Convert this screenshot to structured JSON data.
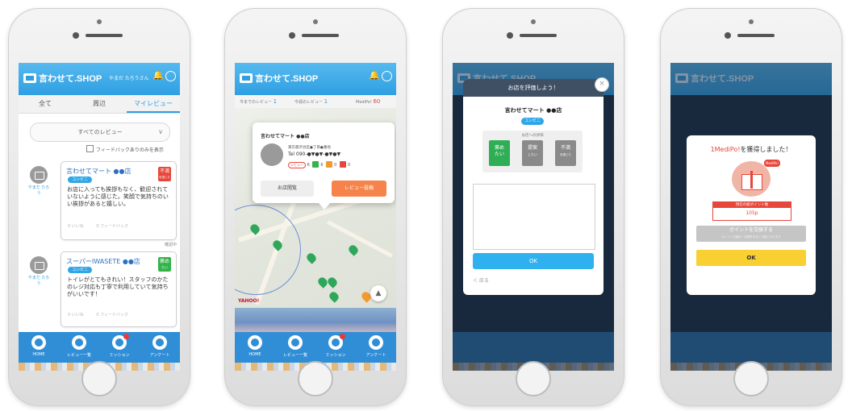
{
  "app": {
    "logo_text": "言わせて.SHOP",
    "username": "やまだ たろうさん"
  },
  "colors": {
    "brand_blue": "#2f9fe2",
    "accent_orange": "#f5834a",
    "positive_green": "#33b34a",
    "negative_red": "#e7463a",
    "ok_yellow": "#f8d031"
  },
  "screen1": {
    "tabs": [
      {
        "label": "全て"
      },
      {
        "label": "周辺"
      },
      {
        "label": "マイレビュー"
      }
    ],
    "dropdown": {
      "value": "すべてのレビュー"
    },
    "filter_checkbox": {
      "label": "フィードバックありのみを表示"
    },
    "reviews": [
      {
        "author": "やまだ たろう",
        "shop": "言わせてマート ●●店",
        "category": "コンビニ",
        "badge": "不満",
        "badge_sub": "を感じた",
        "body": "お店に入っても挨拶もなく、歓迎されていないように感じた。笑顔で気持ちのいい挨拶があると嬉しい。",
        "like_label": "0 いいね",
        "feedback_label": "0 フィードバック",
        "status": "確認中"
      },
      {
        "author": "やまだ たろう",
        "shop": "スーパーIWASETE ●●店",
        "category": "コンビニ",
        "badge": "褒め",
        "badge_sub": "たい",
        "body": "トイレがとてもきれい！スタッフのかたのレジ対応も丁寧で利用していて気持ちがいいです！",
        "like_label": "0 いいね",
        "feedback_label": "0 フィードバック"
      }
    ]
  },
  "nav": [
    {
      "label": "HOME"
    },
    {
      "label": "レビュー一覧"
    },
    {
      "label": "ミッション"
    },
    {
      "label": "アンケート"
    }
  ],
  "screen2": {
    "subtabs": {
      "my_reviews_label": "今までのレビュー",
      "my_reviews_count": "1",
      "monthly_label": "今週のレビュー",
      "monthly_count": "1",
      "medipo_label": "MediPo!",
      "medipo_count": "60"
    },
    "popup": {
      "shop": "言わせてマート ●●店",
      "address": "東京都渋谷区●丁目●番地",
      "tel": "Tel 090-●▼●▼-●▼●▼",
      "review_label": "レビュー",
      "review_count": "6",
      "praise_count": "6",
      "suggest_count": "0",
      "complaint_count": "0",
      "details_button": "お店閲覧",
      "post_button": "レビュー投稿"
    },
    "map_provider": "YAHOO!"
  },
  "screen3": {
    "modal_title": "お店を評価しよう！",
    "shop": "言わせてマート ●●店",
    "category": "コンビニ",
    "eval_label": "お店への評価",
    "options": [
      {
        "label": "褒め",
        "sub": "たい"
      },
      {
        "label": "提案",
        "sub": "したい"
      },
      {
        "label": "不満",
        "sub": "を感じた"
      }
    ],
    "ok_button": "OK",
    "back_link": "＜ 戻る"
  },
  "screen4": {
    "title_prefix": "1MediPo!",
    "title_suffix": "を獲得しました！",
    "tag": "MediPo!",
    "points_label": "現在の総ポイント数",
    "points_value": "105p",
    "exchange_button": "ポイントを交換する",
    "exchange_note": "ポイント交換は一定数貯まると可能になります",
    "ok_button": "OK"
  }
}
